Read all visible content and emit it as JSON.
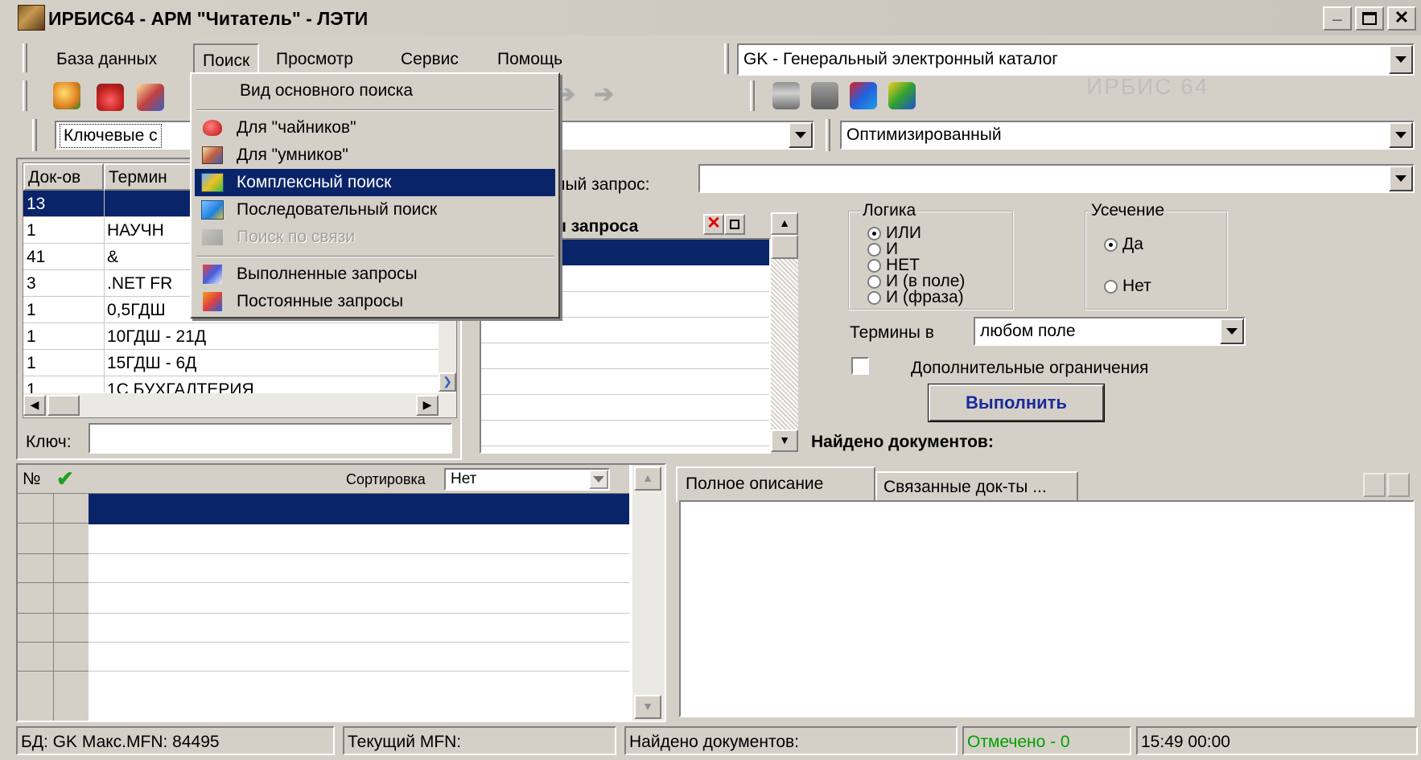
{
  "window": {
    "title": "ИРБИС64 - АРМ \"Читатель\" - ЛЭТИ"
  },
  "menubar": {
    "items": [
      "База данных",
      "Поиск",
      "Просмотр",
      "Сервис",
      "Помощь"
    ]
  },
  "database_select": {
    "value": "GK - Генеральный электронный каталог"
  },
  "watermark": "ИРБИС 64",
  "search_mode": {
    "value": "Ключевые с",
    "method": "Оптимизированный"
  },
  "dropdown_menu": {
    "items": [
      {
        "label": "Вид основного поиска",
        "icon": "none",
        "state": "normal"
      },
      {
        "label": "Для \"чайников\"",
        "icon": "teapot-icon",
        "state": "normal"
      },
      {
        "label": "Для \"умников\"",
        "icon": "book-icon",
        "state": "normal"
      },
      {
        "label": "Комплексный поиск",
        "icon": "complex-search-icon",
        "state": "highlighted"
      },
      {
        "label": "Последовательный поиск",
        "icon": "sequential-search-icon",
        "state": "normal"
      },
      {
        "label": "Поиск по связи",
        "icon": "link-search-icon",
        "state": "disabled"
      },
      {
        "label": "Выполненные запросы",
        "icon": "query-history-icon",
        "state": "normal"
      },
      {
        "label": "Постоянные запросы",
        "icon": "saved-queries-icon",
        "state": "normal"
      }
    ]
  },
  "terms_table": {
    "headers": [
      "Док-ов",
      "Термин"
    ],
    "rows": [
      [
        "13",
        ""
      ],
      [
        "1",
        "НАУЧН"
      ],
      [
        "41",
        "&"
      ],
      [
        "3",
        ".NET FR"
      ],
      [
        "1",
        "0,5ГДШ"
      ],
      [
        "1",
        "10ГДШ - 21Д"
      ],
      [
        "1",
        "15ГДШ - 6Д"
      ],
      [
        "1",
        "1С БУХГАЛТЕРИЯ"
      ]
    ],
    "key_label": "Ключ:"
  },
  "query": {
    "label_tail": "мый запрос:",
    "terms_header_tail": "ы запроса"
  },
  "logic": {
    "title": "Логика",
    "options": [
      "ИЛИ",
      "И",
      "НЕТ",
      "И (в поле)",
      "И (фраза)"
    ],
    "selected": "ИЛИ"
  },
  "truncation": {
    "title": "Усечение",
    "options": [
      "Да",
      "Нет"
    ],
    "selected": "Да"
  },
  "terms_in": {
    "label": "Термины в",
    "value": "любом поле"
  },
  "extra_constraints": {
    "label": "Дополнительные ограничения",
    "checked": false
  },
  "execute_button": "Выполнить",
  "found_label": "Найдено документов:",
  "results": {
    "col_num": "№",
    "sort_label": "Сортировка",
    "sort_value": "Нет"
  },
  "tabs": [
    "Полное описание",
    "Связанные док-ты ..."
  ],
  "status": {
    "db": "БД: GK Макс.MFN: 84495",
    "current": "Текущий MFN:",
    "found": "Найдено документов:",
    "marked": "Отмечено - 0",
    "time": "15:49  00:00"
  },
  "colors": {
    "titlebar": "#0a246a",
    "highlight": "#0a246a",
    "marked_text": "#00a000",
    "execute_text": "#1a2a9a",
    "face": "#d4d0c8"
  }
}
